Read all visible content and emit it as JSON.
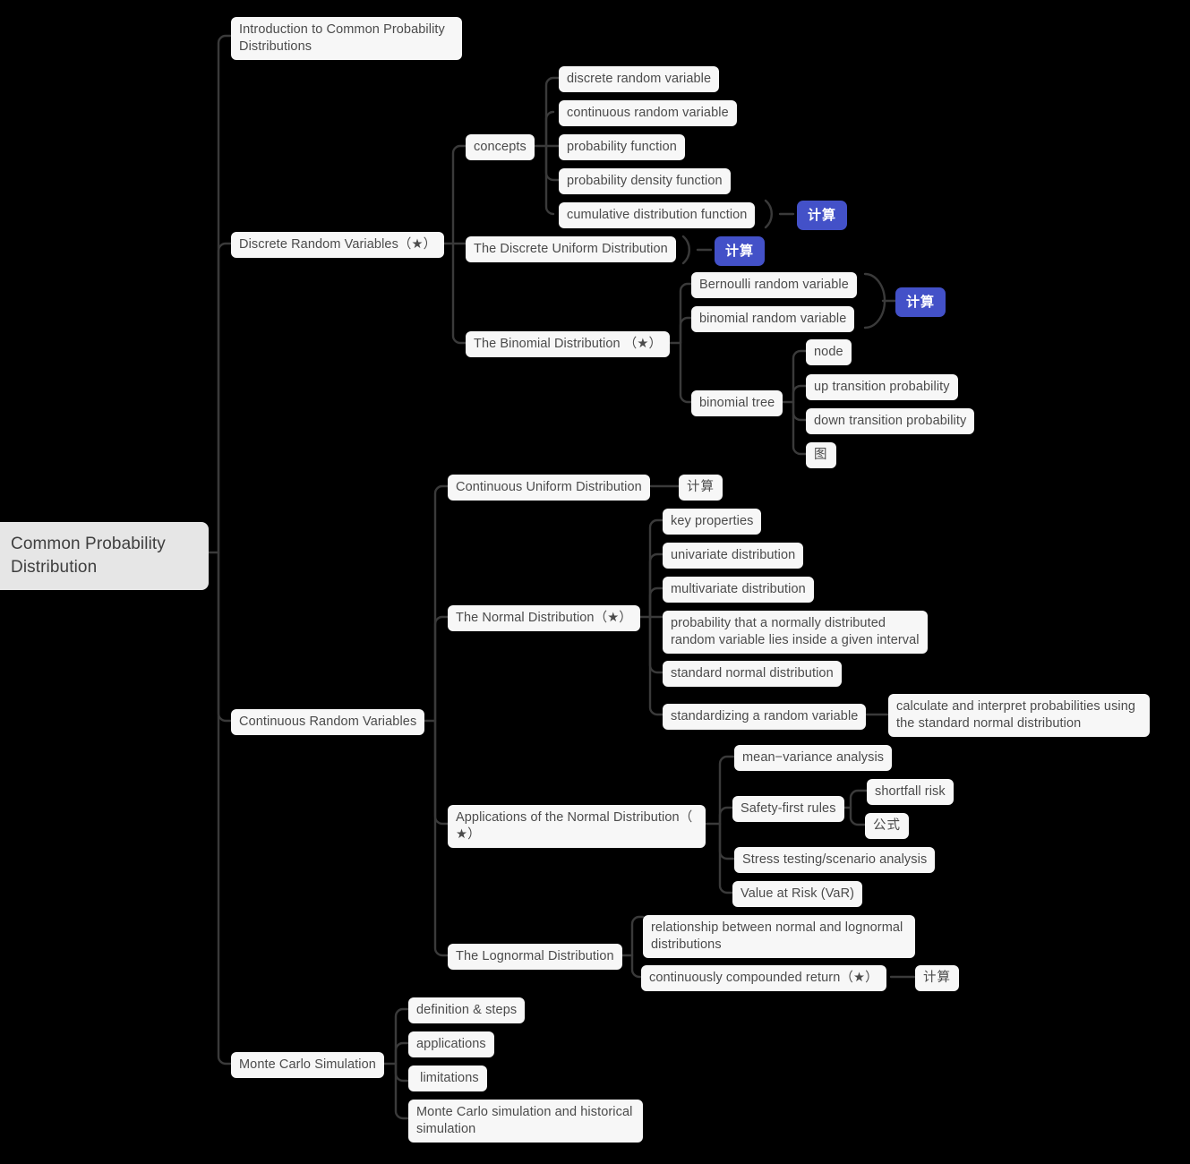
{
  "meta": {
    "title": "Common Probability Distribution",
    "diagram_type": "mind-map",
    "background_color": "#000000",
    "node_color": "#f7f7f7",
    "node_text_color": "#4b4b4b",
    "root_color": "#e6e6e6",
    "badge_color": "#4351c8",
    "badge_text_color": "#ffffff",
    "connector_color": "#3a3a3a"
  },
  "root": {
    "label": "Common Probability\nDistribution"
  },
  "nodes": {
    "intro": "Introduction to Common Probability\nDistributions",
    "discrete_rv": "Discrete Random Variables（★）",
    "concepts": "concepts",
    "discrete_random_variable": "discrete random variable",
    "continuous_random_variable": "continuous random variable",
    "probability_function": "probability function",
    "probability_density_function": "probability density function",
    "cumulative_distribution_function": "cumulative distribution function",
    "badge_cdf": "计算",
    "discrete_uniform": "The Discrete Uniform Distribution",
    "badge_discrete_uniform": "计算",
    "binomial_distribution": "The Binomial Distribution （★）",
    "bernoulli_rv": "Bernoulli random variable",
    "binomial_rv": "binomial random variable",
    "badge_binomial": "计算",
    "binomial_tree": "binomial tree",
    "node_label": "node",
    "up_transition": "up transition probability",
    "down_transition": "down transition probability",
    "tree_figure": "图",
    "continuous_rv": "Continuous Random Variables",
    "continuous_uniform": "Continuous Uniform Distribution",
    "continuous_uniform_calc": "计算",
    "normal_distribution": "The Normal Distribution（★）",
    "key_properties": "key properties",
    "univariate": "univariate distribution",
    "multivariate": "multivariate distribution",
    "prob_interval": "probability that a normally distributed\nrandom variable lies inside a given interval",
    "standard_normal": "standard normal distribution",
    "standardizing": "standardizing a random variable",
    "calc_interpret": "calculate and interpret probabilities using\nthe standard normal distribution",
    "applications_normal": "Applications of the Normal Distribution（\n★）",
    "mean_variance": "mean−variance analysis",
    "safety_first": "Safety-first rules",
    "shortfall_risk": "shortfall risk",
    "formula": "公式",
    "stress_testing": "Stress testing/scenario analysis",
    "value_at_risk": "Value at Risk (VaR)",
    "lognormal": "The Lognormal Distribution",
    "relationship_normal_lognormal": "relationship between normal and lognormal\ndistributions",
    "continuously_compounded": "continuously compounded return（★）",
    "continuously_compounded_calc": "计算",
    "monte_carlo": "Monte Carlo Simulation",
    "definition_steps": "definition & steps",
    "applications": "applications",
    "limitations": " limitations",
    "mc_vs_historical": "Monte Carlo simulation and historical\nsimulation"
  }
}
